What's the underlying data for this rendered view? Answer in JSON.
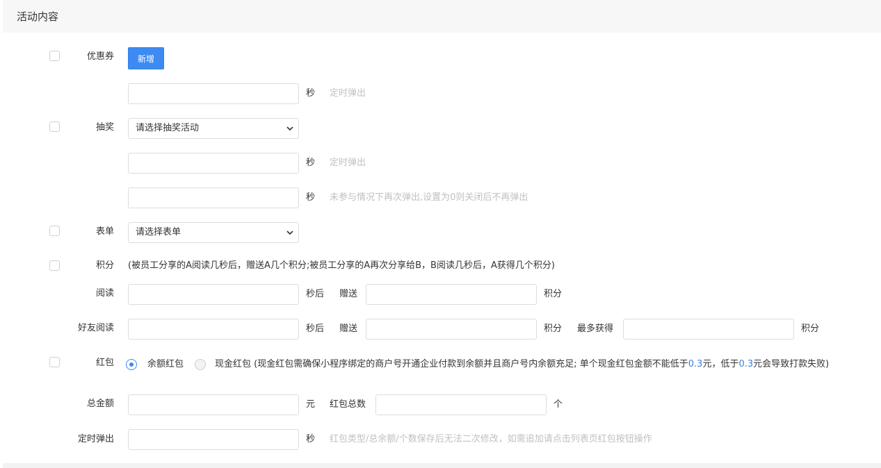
{
  "section": {
    "title": "活动内容"
  },
  "coupon": {
    "label": "优惠券",
    "add_button": "新增",
    "unit": "秒",
    "hint": "定时弹出"
  },
  "lottery": {
    "label": "抽奖",
    "select_value": "请选择抽奖活动",
    "unit1": "秒",
    "hint1": "定时弹出",
    "unit2": "秒",
    "hint2": "未参与情况下再次弹出,设置为0则关闭后不再弹出"
  },
  "form": {
    "label": "表单",
    "select_value": "请选择表单"
  },
  "points": {
    "label": "积分",
    "description": "(被员工分享的A阅读几秒后，赠送A几个积分;被员工分享的A再次分享给B，B阅读几秒后，A获得几个积分)",
    "read_label": "阅读",
    "after_seconds": "秒后",
    "give": "赠送",
    "points_unit": "积分",
    "friend_read_label": "好友阅读",
    "max_get": "最多获得"
  },
  "redpacket": {
    "label": "红包",
    "option_balance": "余额红包",
    "option_cash": "现金红包",
    "cash_note_pre": "(现金红包需确保小程序绑定的商户号开通企业付款到余额并且商户号内余额充足; 单个现金红包金额不能低于",
    "amount": "0.3",
    "cash_note_mid": "元，低于",
    "cash_note_post": "元会导致打款失败)",
    "total_label": "总金额",
    "yuan": "元",
    "count_label": "红包总数",
    "count_unit": "个",
    "popup_label": "定时弹出",
    "popup_unit": "秒",
    "popup_hint": "红包类型/总余额/个数保存后无法二次修改，如需追加请点击列表页红包按钮操作"
  }
}
